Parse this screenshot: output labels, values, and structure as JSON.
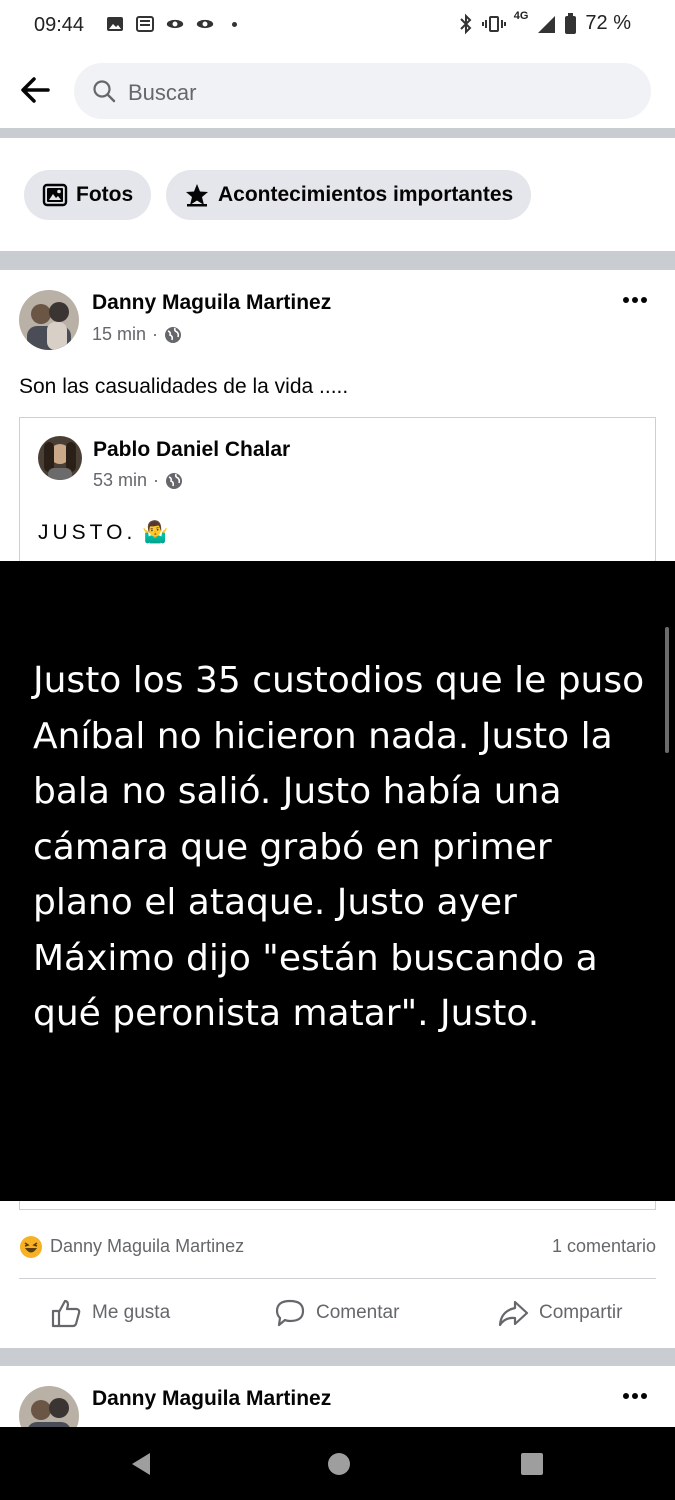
{
  "status_bar": {
    "time": "09:44",
    "battery": "72 %",
    "network": "4G"
  },
  "search": {
    "placeholder": "Buscar"
  },
  "chips": [
    {
      "label": "Fotos",
      "icon": "photos-icon"
    },
    {
      "label": "Acontecimientos importantes",
      "icon": "star-icon"
    }
  ],
  "post": {
    "author": "Danny Maguila Martinez",
    "time": "15 min",
    "privacy_separator": "·",
    "text": "Son las casualidades de la vida .....",
    "shared": {
      "author": "Pablo Daniel Chalar",
      "time": "53 min",
      "text": "JUSTO.",
      "emoji": "🤷‍♂️",
      "image_text": "Justo los 35 custodios que le puso Aníbal no hicieron nada. Justo la bala no salió. Justo había una cámara que grabó en primer plano el ataque. Justo ayer Máximo dijo \"están buscando a qué peronista matar\". Justo."
    },
    "reaction_name": "Danny Maguila Martinez",
    "comment_count": "1 comentario",
    "actions": {
      "like": "Me gusta",
      "comment": "Comentar",
      "share": "Compartir"
    }
  },
  "next_post": {
    "author": "Danny Maguila Martinez"
  },
  "colors": {
    "secondary_text": "#65676b",
    "chip_bg": "#e4e6eb",
    "search_bg": "#f0f2f5",
    "divider": "#c9ccd1"
  }
}
